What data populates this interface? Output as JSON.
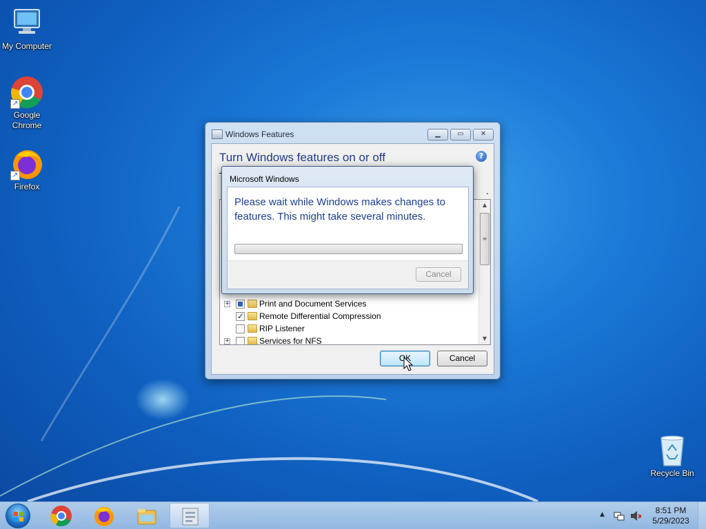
{
  "desktop": {
    "icons": [
      {
        "label": "My Computer",
        "icon": "computer-icon"
      },
      {
        "label": "Google Chrome",
        "label_line1": "Google",
        "label_line2": "Chrome",
        "icon": "chrome-icon"
      },
      {
        "label": "Firefox",
        "icon": "firefox-icon"
      },
      {
        "label": "Recycle Bin",
        "icon": "recycle-bin-icon"
      }
    ]
  },
  "features_window": {
    "title": "Windows Features",
    "heading": "Turn Windows features on or off",
    "obscured_char_left": "T",
    "obscured_char_right": ".",
    "tree_items": [
      {
        "name": "Print and Document Services",
        "expandable": true,
        "state": "partial"
      },
      {
        "name": "Remote Differential Compression",
        "expandable": false,
        "state": "checked"
      },
      {
        "name": "RIP Listener",
        "expandable": false,
        "state": "unchecked"
      },
      {
        "name": "Services for NFS",
        "expandable": true,
        "state": "unchecked"
      }
    ],
    "ok_label": "OK",
    "cancel_label": "Cancel"
  },
  "progress_dialog": {
    "title": "Microsoft Windows",
    "message": "Please wait while Windows makes changes to features. This might take several minutes.",
    "progress_fraction": 0.0,
    "cancel_label": "Cancel"
  },
  "taskbar": {
    "pinned": [
      "chrome-icon",
      "firefox-icon",
      "file-explorer-icon",
      "windows-features-icon"
    ],
    "clock_time": "8:51 PM",
    "clock_date": "5/29/2023"
  },
  "colors": {
    "heading_blue": "#1e3a8a",
    "dialog_text_blue": "#1a3f8f",
    "default_button": "#bee6fd"
  }
}
